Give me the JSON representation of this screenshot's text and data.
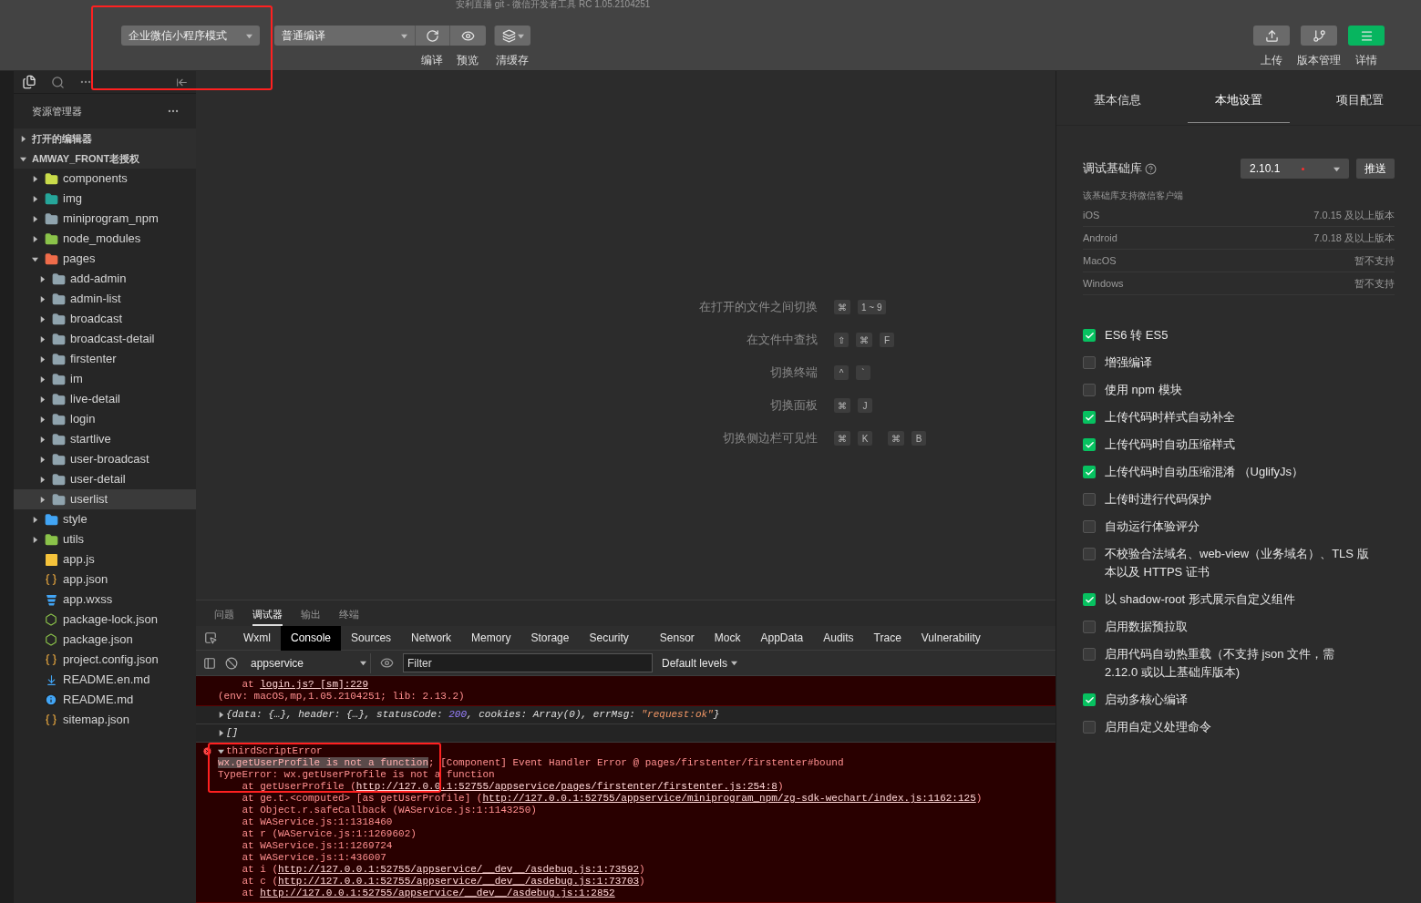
{
  "window": {
    "title": "安利直播 git - 微信开发者工具 RC 1.05.2104251"
  },
  "toolbar": {
    "mode_select": "企业微信小程序模式",
    "compile_select": "普通编译",
    "tools": [
      {
        "kind": "refresh",
        "label": "编译"
      },
      {
        "kind": "eye",
        "label": "预览"
      },
      {
        "kind": "layers",
        "label": "清缓存"
      }
    ],
    "actions": [
      {
        "kind": "upload",
        "label": "上传",
        "primary": false
      },
      {
        "kind": "branch",
        "label": "版本管理",
        "primary": false
      },
      {
        "kind": "menu",
        "label": "详情",
        "primary": true
      }
    ]
  },
  "sidebar": {
    "title": "资源管理器",
    "sections": [
      {
        "label": "打开的编辑器",
        "expanded": false
      },
      {
        "label": "AMWAY_FRONT老授权",
        "expanded": true,
        "children": [
          {
            "name": "components",
            "kind": "components",
            "expanded": false,
            "selected": false
          },
          {
            "name": "img",
            "kind": "img",
            "expanded": false,
            "selected": false
          },
          {
            "name": "miniprogram_npm",
            "kind": "folder",
            "expanded": false,
            "selected": false
          },
          {
            "name": "node_modules",
            "kind": "node",
            "expanded": false,
            "selected": false
          },
          {
            "name": "pages",
            "kind": "pages",
            "expanded": true,
            "selected": false,
            "children": [
              {
                "name": "add-admin",
                "kind": "folder",
                "expanded": false,
                "selected": false
              },
              {
                "name": "admin-list",
                "kind": "folder",
                "expanded": false,
                "selected": false
              },
              {
                "name": "broadcast",
                "kind": "folder",
                "expanded": false,
                "selected": false
              },
              {
                "name": "broadcast-detail",
                "kind": "folder",
                "expanded": false,
                "selected": false
              },
              {
                "name": "firstenter",
                "kind": "folder",
                "expanded": false,
                "selected": false
              },
              {
                "name": "im",
                "kind": "folder",
                "expanded": false,
                "selected": false
              },
              {
                "name": "live-detail",
                "kind": "folder",
                "expanded": false,
                "selected": false
              },
              {
                "name": "login",
                "kind": "folder",
                "expanded": false,
                "selected": false
              },
              {
                "name": "startlive",
                "kind": "folder",
                "expanded": false,
                "selected": false
              },
              {
                "name": "user-broadcast",
                "kind": "folder",
                "expanded": false,
                "selected": false
              },
              {
                "name": "user-detail",
                "kind": "folder",
                "expanded": false,
                "selected": false
              },
              {
                "name": "userlist",
                "kind": "folder",
                "expanded": false,
                "selected": true
              }
            ]
          },
          {
            "name": "style",
            "kind": "style",
            "expanded": false,
            "selected": false
          },
          {
            "name": "utils",
            "kind": "utils",
            "expanded": false,
            "selected": false
          },
          {
            "name": "app.js",
            "kind": "js",
            "selected": false
          },
          {
            "name": "app.json",
            "kind": "json",
            "selected": false
          },
          {
            "name": "app.wxss",
            "kind": "wxss",
            "selected": false
          },
          {
            "name": "package-lock.json",
            "kind": "npm-json",
            "selected": false
          },
          {
            "name": "package.json",
            "kind": "npm-json",
            "selected": false
          },
          {
            "name": "project.config.json",
            "kind": "json",
            "selected": false
          },
          {
            "name": "README.en.md",
            "kind": "markdown",
            "selected": false
          },
          {
            "name": "README.md",
            "kind": "info",
            "selected": false
          },
          {
            "name": "sitemap.json",
            "kind": "json",
            "selected": false
          }
        ]
      }
    ]
  },
  "shortcuts": [
    {
      "label": "在打开的文件之间切换",
      "keys": [
        [
          "⌘",
          "1 ~ 9"
        ]
      ]
    },
    {
      "label": "在文件中查找",
      "keys": [
        [
          "⇧",
          "⌘",
          "F"
        ]
      ]
    },
    {
      "label": "切换终端",
      "keys": [
        [
          "^",
          "`"
        ]
      ]
    },
    {
      "label": "切换面板",
      "keys": [
        [
          "⌘",
          "J"
        ]
      ]
    },
    {
      "label": "切换侧边栏可见性",
      "keys": [
        [
          "⌘",
          "K"
        ],
        [
          "⌘",
          "B"
        ]
      ]
    }
  ],
  "panel": {
    "tabs": [
      {
        "label": "问题",
        "selected": false
      },
      {
        "label": "调试器",
        "selected": true
      },
      {
        "label": "输出",
        "selected": false
      },
      {
        "label": "终端",
        "selected": false
      }
    ],
    "devtools_tabs": [
      {
        "label": "Wxml",
        "selected": false
      },
      {
        "label": "Console",
        "selected": true
      },
      {
        "label": "Sources",
        "selected": false
      },
      {
        "label": "Network",
        "selected": false
      },
      {
        "label": "Memory",
        "selected": false
      },
      {
        "label": "Storage",
        "selected": false
      },
      {
        "label": "Security",
        "selected": false
      },
      {
        "label": "Sensor",
        "selected": false
      },
      {
        "label": "Mock",
        "selected": false
      },
      {
        "label": "AppData",
        "selected": false
      },
      {
        "label": "Audits",
        "selected": false
      },
      {
        "label": "Trace",
        "selected": false
      },
      {
        "label": "Vulnerability",
        "selected": false
      }
    ],
    "context": "appservice",
    "filter_placeholder": "Filter",
    "levels": "Default levels",
    "console": [
      {
        "kind": "error",
        "error_icon": false,
        "lines": [
          [
            {
              "text": "    at ",
              "kind": "text"
            },
            {
              "text": "login.js? [sm]:229",
              "kind": "link"
            }
          ],
          [
            {
              "text": "(env: macOS,mp,1.05.2104251; lib: 2.13.2)",
              "kind": "text"
            }
          ]
        ]
      },
      {
        "kind": "log",
        "expanded": false,
        "lines": [
          [
            {
              "text": "{data: {…}, header: {…}, statusCode: ",
              "kind": "text"
            },
            {
              "text": "200",
              "kind": "number"
            },
            {
              "text": ", cookies: Array(0), errMsg: ",
              "kind": "text"
            },
            {
              "text": "\"request:ok\"",
              "kind": "string"
            },
            {
              "text": "}",
              "kind": "text"
            }
          ]
        ]
      },
      {
        "kind": "log",
        "expanded": false,
        "lines": [
          [
            {
              "text": "[]",
              "kind": "text"
            }
          ]
        ]
      },
      {
        "kind": "error",
        "error_icon": true,
        "expanded": true,
        "lines": [
          [
            {
              "text": "thirdScriptError",
              "kind": "text"
            }
          ],
          [
            {
              "text": "wx.getUserProfile is not a function",
              "kind": "highlight"
            },
            {
              "text": "; [Component] Event Handler Error @ pages/firstenter/firstenter#bound",
              "kind": "text"
            }
          ],
          [
            {
              "text": "TypeError: wx.getUserProfile is not a function",
              "kind": "text"
            }
          ],
          [
            {
              "text": "    at getUserProfile (",
              "kind": "text"
            },
            {
              "text": "http://127.0.0.1:52755/appservice/pages/firstenter/firstenter.js:254:8",
              "kind": "link"
            },
            {
              "text": ")",
              "kind": "text"
            }
          ],
          [
            {
              "text": "    at ge.t.<computed> [as getUserProfile] (",
              "kind": "text"
            },
            {
              "text": "http://127.0.0.1:52755/appservice/miniprogram_npm/zg-sdk-wechart/index.js:1162:125",
              "kind": "link"
            },
            {
              "text": ")",
              "kind": "text"
            }
          ],
          [
            {
              "text": "    at Object.r.safeCallback (WAService.js:1:1143250)",
              "kind": "text"
            }
          ],
          [
            {
              "text": "    at WAService.js:1:1318460",
              "kind": "text"
            }
          ],
          [
            {
              "text": "    at r (WAService.js:1:1269602)",
              "kind": "text"
            }
          ],
          [
            {
              "text": "    at WAService.js:1:1269724",
              "kind": "text"
            }
          ],
          [
            {
              "text": "    at WAService.js:1:436007",
              "kind": "text"
            }
          ],
          [
            {
              "text": "    at i (",
              "kind": "text"
            },
            {
              "text": "http://127.0.0.1:52755/appservice/__dev__/asdebug.js:1:73592",
              "kind": "link"
            },
            {
              "text": ")",
              "kind": "text"
            }
          ],
          [
            {
              "text": "    at c (",
              "kind": "text"
            },
            {
              "text": "http://127.0.0.1:52755/appservice/__dev__/asdebug.js:1:73703",
              "kind": "link"
            },
            {
              "text": ")",
              "kind": "text"
            }
          ],
          [
            {
              "text": "    at ",
              "kind": "text"
            },
            {
              "text": "http://127.0.0.1:52755/appservice/__dev__/asdebug.js:1:2852",
              "kind": "link"
            }
          ]
        ]
      }
    ]
  },
  "settings": {
    "tabs": [
      {
        "label": "基本信息",
        "selected": false
      },
      {
        "label": "本地设置",
        "selected": true
      },
      {
        "label": "项目配置",
        "selected": false
      }
    ],
    "library_label": "调试基础库",
    "library_version": "2.10.1",
    "push_button": "推送",
    "support_title": "该基础库支持微信客户端",
    "support": [
      {
        "platform": "iOS",
        "version": "7.0.15 及以上版本"
      },
      {
        "platform": "Android",
        "version": "7.0.18 及以上版本"
      },
      {
        "platform": "MacOS",
        "version": "暂不支持"
      },
      {
        "platform": "Windows",
        "version": "暂不支持"
      }
    ],
    "options": [
      {
        "label": "ES6 转 ES5",
        "checked": true
      },
      {
        "label": "增强编译",
        "checked": false
      },
      {
        "label": "使用 npm 模块",
        "checked": false
      },
      {
        "label": "上传代码时样式自动补全",
        "checked": true
      },
      {
        "label": "上传代码时自动压缩样式",
        "checked": true
      },
      {
        "label": "上传代码时自动压缩混淆 （UglifyJs）",
        "checked": true
      },
      {
        "label": "上传时进行代码保护",
        "checked": false
      },
      {
        "label": "自动运行体验评分",
        "checked": false
      },
      {
        "label": "不校验合法域名、web-view（业务域名）、TLS 版本以及 HTTPS 证书",
        "checked": false
      },
      {
        "label": "以 shadow-root 形式展示自定义组件",
        "checked": true
      },
      {
        "label": "启用数据预拉取",
        "checked": false
      },
      {
        "label": "启用代码自动热重载（不支持 json 文件，需 2.12.0 或以上基础库版本)",
        "checked": false
      },
      {
        "label": "启动多核心编译",
        "checked": true
      },
      {
        "label": "启用自定义处理命令",
        "checked": false
      }
    ]
  }
}
